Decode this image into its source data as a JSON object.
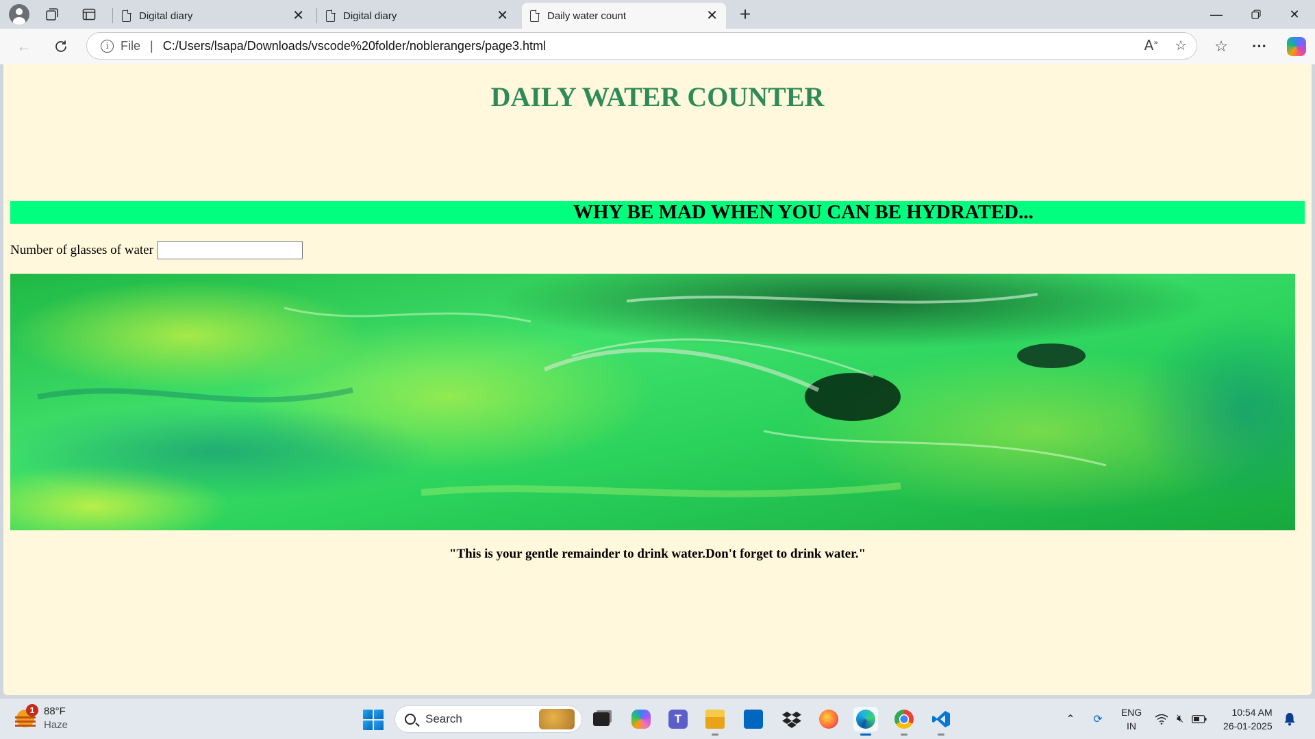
{
  "browser": {
    "tabs": [
      {
        "label": "Digital diary",
        "active": false
      },
      {
        "label": "Digital diary",
        "active": false
      },
      {
        "label": "Daily water count",
        "active": true
      }
    ],
    "address": {
      "scheme_label": "File",
      "url": "C:/Users/lsapa/Downloads/vscode%20folder/noblerangers/page3.html"
    },
    "icons": {
      "profile": "profile-icon",
      "workspaces": "workspaces-icon",
      "tab_actions": "vertical-tabs-icon",
      "new_tab": "plus-icon",
      "back": "back-arrow-icon",
      "refresh": "refresh-icon",
      "read_aloud": "read-aloud-icon",
      "favorite": "star-icon",
      "favorites": "favorites-icon",
      "menu": "more-icon",
      "copilot": "copilot-icon"
    }
  },
  "page": {
    "title": "DAILY WATER COUNTER",
    "banner": "WHY BE MAD WHEN YOU CAN BE HYDRATED...",
    "glass_label": "Number of glasses of water",
    "glass_value": "",
    "quote": "\"This is your gentle remainder to drink water.Don't forget to drink water.\"",
    "colors": {
      "background": "#fff8dc",
      "title": "#2e8b57",
      "banner": "#00ff7f",
      "image_tint": "#1fd34a"
    }
  },
  "taskbar": {
    "weather": {
      "temp": "88°F",
      "condition": "Haze",
      "badge": "1"
    },
    "search_placeholder": "Search",
    "apps": [
      "task-view-icon",
      "copilot-app-icon",
      "teams-icon",
      "file-explorer-icon",
      "ms-store-icon",
      "dropbox-icon",
      "firefox-icon",
      "edge-icon",
      "chrome-icon",
      "vscode-icon"
    ],
    "lang": {
      "line1": "ENG",
      "line2": "IN"
    },
    "clock": {
      "time": "10:54 AM",
      "date": "26-01-2025"
    }
  }
}
